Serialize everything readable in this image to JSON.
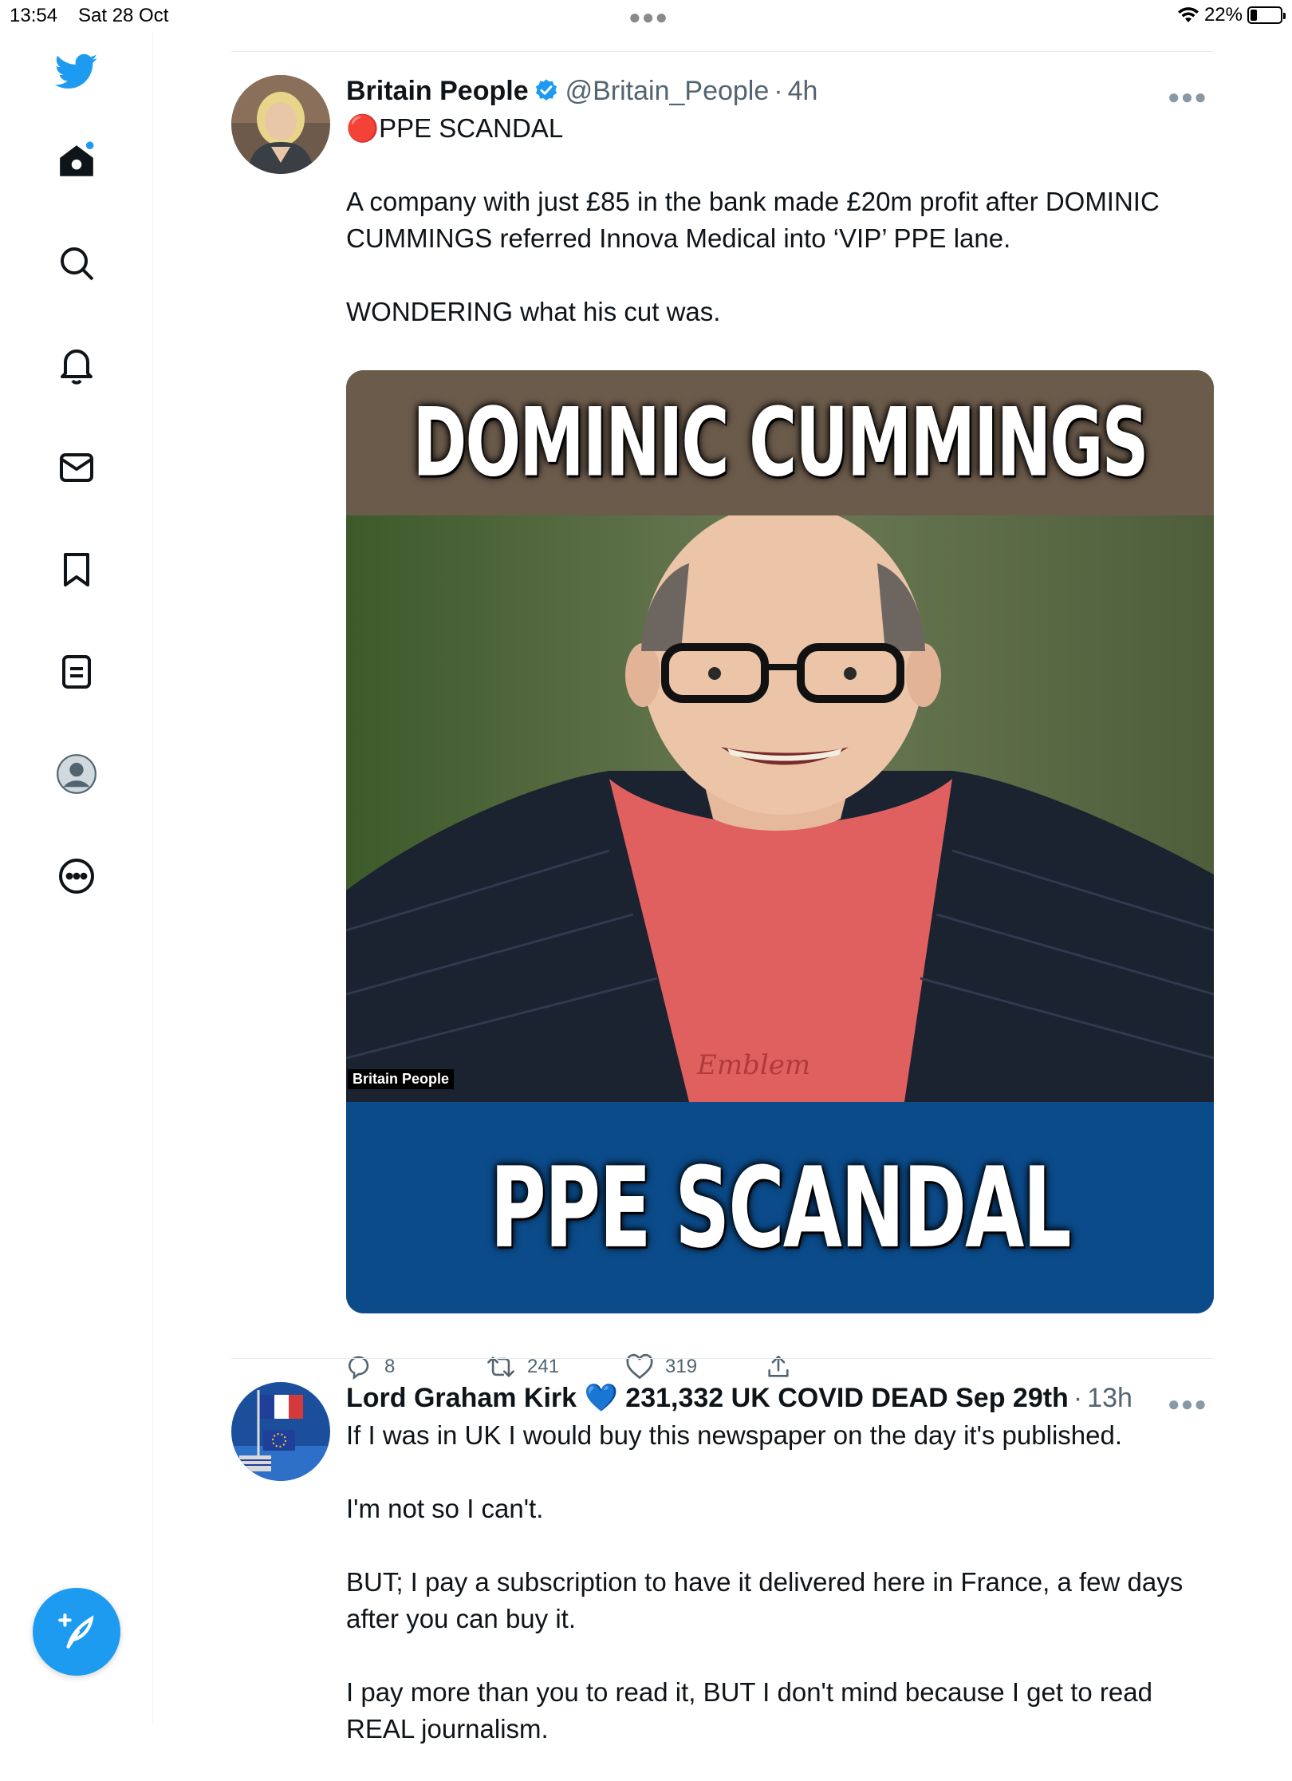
{
  "status_bar": {
    "time": "13:54",
    "date": "Sat 28 Oct",
    "battery": "22%",
    "battery_level": 0.22
  },
  "sidebar": {
    "items": [
      {
        "name": "twitter-logo-icon"
      },
      {
        "name": "home-icon"
      },
      {
        "name": "search-icon"
      },
      {
        "name": "notifications-icon"
      },
      {
        "name": "messages-icon"
      },
      {
        "name": "bookmarks-icon"
      },
      {
        "name": "lists-icon"
      },
      {
        "name": "profile-icon"
      },
      {
        "name": "more-icon"
      }
    ],
    "compose_icon": "compose-tweet-icon"
  },
  "tweets": [
    {
      "author": "Britain People",
      "verified": true,
      "handle": "@Britain_People",
      "time": "4h",
      "text_line1": "🔴PPE SCANDAL",
      "text_body": "A company with just £85 in the bank made £20m profit after DOMINIC CUMMINGS referred Innova Medical into ‘VIP’ PPE lane.\n\nWONDERING what his cut was.",
      "media": {
        "top_text": "DOMINIC CUMMINGS",
        "bottom_text": "PPE SCANDAL",
        "watermark": "Britain People"
      },
      "replies": "8",
      "retweets": "241",
      "likes": "319"
    },
    {
      "author": "Lord Graham Kirk 💙 231,332 UK COVID DEAD Sep 29th",
      "handle": "",
      "time": "13h",
      "text_body": "If I was in UK I would buy this newspaper on the day it's published.\n\nI'm not so I can't.\n\nBUT; I pay a subscription to have it delivered here in France, a few days after you can buy it.\n\nI pay more than you to read it, BUT I don't mind because I get to read REAL journalism."
    }
  ],
  "colors": {
    "accent": "#1d9bf0",
    "text": "#0f1419",
    "secondary": "#536471"
  }
}
